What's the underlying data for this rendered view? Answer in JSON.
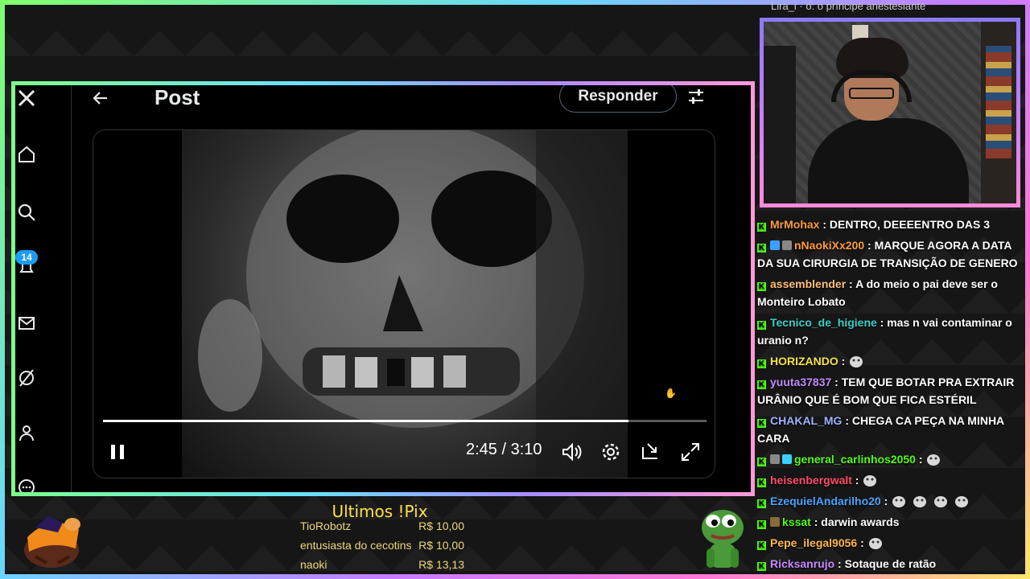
{
  "x_app": {
    "header": {
      "title": "Post",
      "reply_label": "Responder"
    },
    "notification_count": "14",
    "video": {
      "time_display": "2:45 / 3:10",
      "progress": 0.87
    }
  },
  "chat": {
    "top_partial": "Lira_i · o: o príncipe anestesiante",
    "messages": [
      {
        "user": "MrMohax",
        "color": "#ff9c3a",
        "text": "DENTRO, DEEEENTRO DAS 3"
      },
      {
        "user": "nNaokiXx200",
        "color": "#ff9c3a",
        "text": "MARQUE AGORA A DATA DA SUA CIRURGIA DE TRANSIÇÃO DE GENERO",
        "badges": [
          "#3aa0ff",
          "#888"
        ]
      },
      {
        "user": "assemblender",
        "color": "#ffc07a",
        "text": "A do meio o pai deve ser o Monteiro Lobato"
      },
      {
        "user": "Tecnico_de_higiene",
        "color": "#3ad0c8",
        "text": "mas n vai contaminar o uranio n?"
      },
      {
        "user": "HORIZANDO",
        "color": "#f5e342",
        "text": "",
        "emotes": 1
      },
      {
        "user": "yuuta37837",
        "color": "#c48aff",
        "text": "TEM QUE BOTAR PRA EXTRAIR URÂNIO QUE É BOM QUE FICA ESTÉRIL"
      },
      {
        "user": "CHAKAL_MG",
        "color": "#9fb3ff",
        "text": "CHEGA CA PEÇA NA MINHA CARA"
      },
      {
        "user": "general_carlinhos2050",
        "color": "#53fc18",
        "text": "",
        "emotes": 1,
        "badges": [
          "#888",
          "#3ad0ff"
        ]
      },
      {
        "user": "heisenbergwalt",
        "color": "#ff4d6a",
        "text": "",
        "emotes": 1
      },
      {
        "user": "EzequielAndarilho20",
        "color": "#4aa3ff",
        "text": "",
        "emotes": 4
      },
      {
        "user": "kssat",
        "color": "#53fc18",
        "text": "darwin awards",
        "badges": [
          "#8a6a3a"
        ]
      },
      {
        "user": "Pepe_ilegal9056",
        "color": "#ffb84a",
        "text": "",
        "emotes": 1
      },
      {
        "user": "Ricksanrujo",
        "color": "#c48aff",
        "text": "Sotaque de ratão"
      }
    ]
  },
  "pix": {
    "title": "Ultimos !Pix",
    "rows": [
      {
        "name": "TioRobotz",
        "value": "R$ 10,00"
      },
      {
        "name": "entusiasta do cecotins",
        "value": "R$ 10,00"
      },
      {
        "name": "naoki",
        "value": "R$ 13,13"
      }
    ]
  },
  "colors": {
    "kick_green": "#53fc18",
    "x_blue": "#1d9bf0",
    "pix_gold": "#ffe04a"
  }
}
